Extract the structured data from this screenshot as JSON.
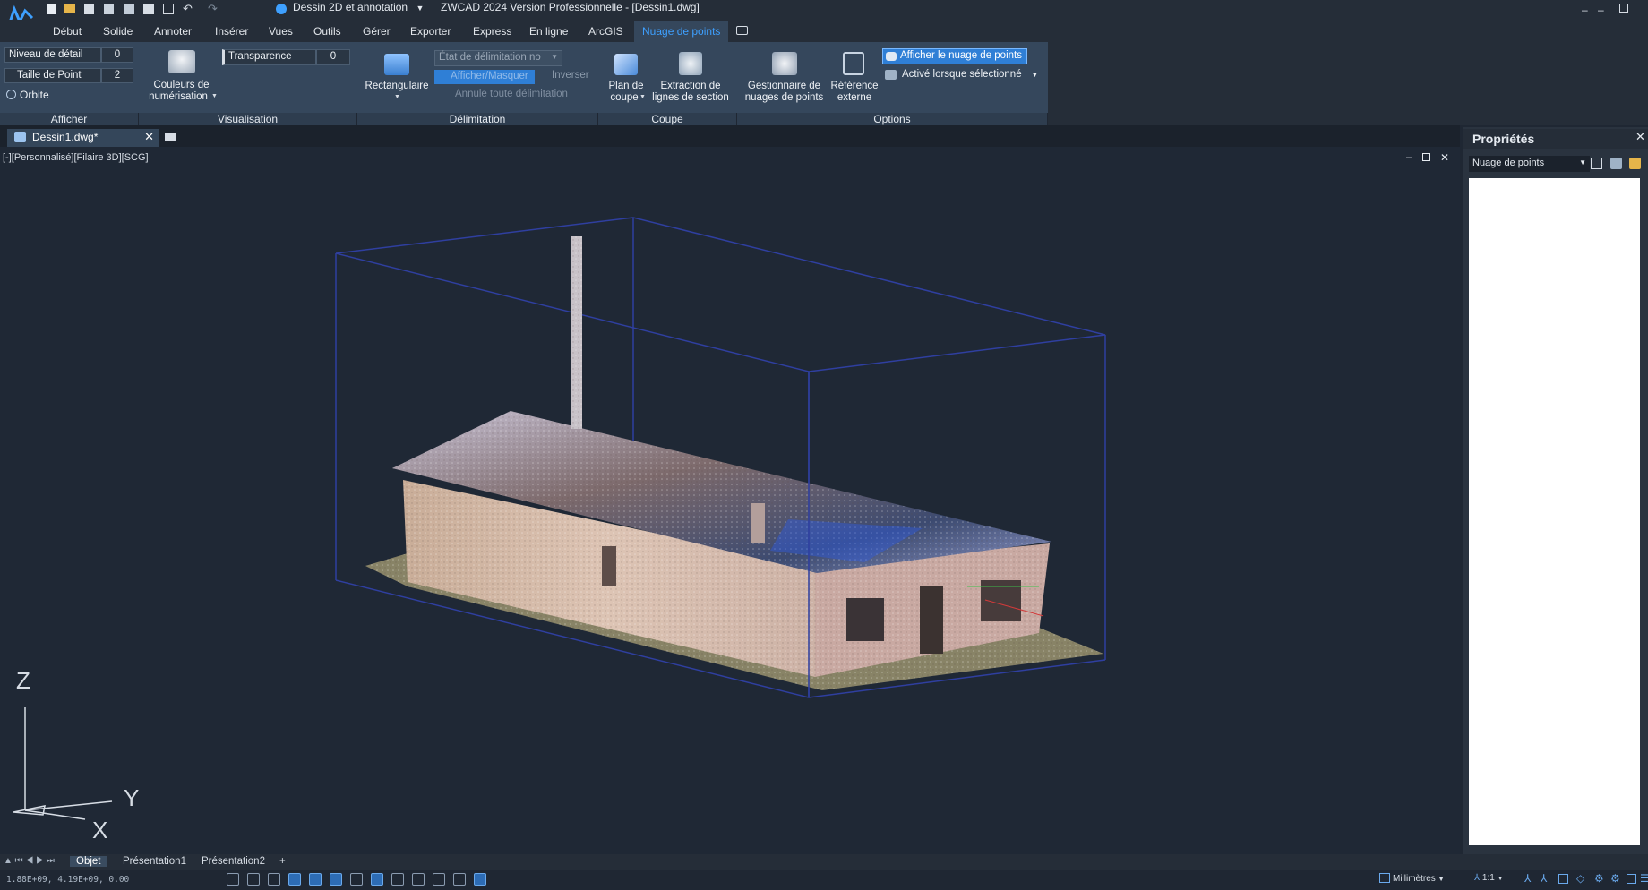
{
  "titlebar": {
    "workspace": "Dessin 2D et annotation",
    "title": "ZWCAD 2024 Version Professionnelle - [Dessin1.dwg]"
  },
  "menu_tabs": [
    "Début",
    "Solide",
    "Annoter",
    "Insérer",
    "Vues",
    "Outils",
    "Gérer",
    "Exporter",
    "Express",
    "En ligne",
    "ArcGIS",
    "Nuage de points"
  ],
  "ribbon": {
    "afficher": {
      "niveau_label": "Niveau de détail",
      "niveau_value": "0",
      "taille_label": "Taille de Point",
      "taille_value": "2",
      "orbite_label": "Orbite",
      "footer": "Afficher"
    },
    "visualisation": {
      "couleurs_label1": "Couleurs de",
      "couleurs_label2": "numérisation",
      "transparence_label": "Transparence",
      "transparence_value": "0",
      "footer": "Visualisation"
    },
    "delimitation": {
      "rect_label": "Rectangulaire",
      "etat_placeholder": "État de délimitation no",
      "afficher_masquer": "Afficher/Masquer",
      "inverser": "Inverser",
      "annule": "Annule toute délimitation",
      "footer": "Délimitation"
    },
    "coupe": {
      "plan_label1": "Plan de",
      "plan_label2": "coupe",
      "extraction_label1": "Extraction de",
      "extraction_label2": "lignes de section",
      "footer": "Coupe"
    },
    "options": {
      "gestionnaire_label1": "Gestionnaire de",
      "gestionnaire_label2": "nuages de points",
      "reference_label1": "Référence",
      "reference_label2": "externe",
      "afficher_nuage": "Afficher le nuage de points",
      "active_label": "Activé lorsque sélectionné",
      "footer": "Options"
    }
  },
  "document": {
    "tab": "Dessin1.dwg*",
    "view_label": "[-][Personnalisé][Filaire 3D][SCG]"
  },
  "axes": {
    "z": "Z",
    "y": "Y",
    "x": "X"
  },
  "properties": {
    "title": "Propriétés",
    "selection": "Nuage de points"
  },
  "layout_tabs": [
    "Objet",
    "Présentation1",
    "Présentation2",
    "+"
  ],
  "status": {
    "coords": "1.88E+09, 4.19E+09, 0.00",
    "units": "Millimètres",
    "scale": "1:1"
  },
  "colors": {
    "accent": "#3ea0ff",
    "ribbon": "#35475c",
    "viewport": "#1f2835",
    "bbox": "#2f3fa0"
  }
}
